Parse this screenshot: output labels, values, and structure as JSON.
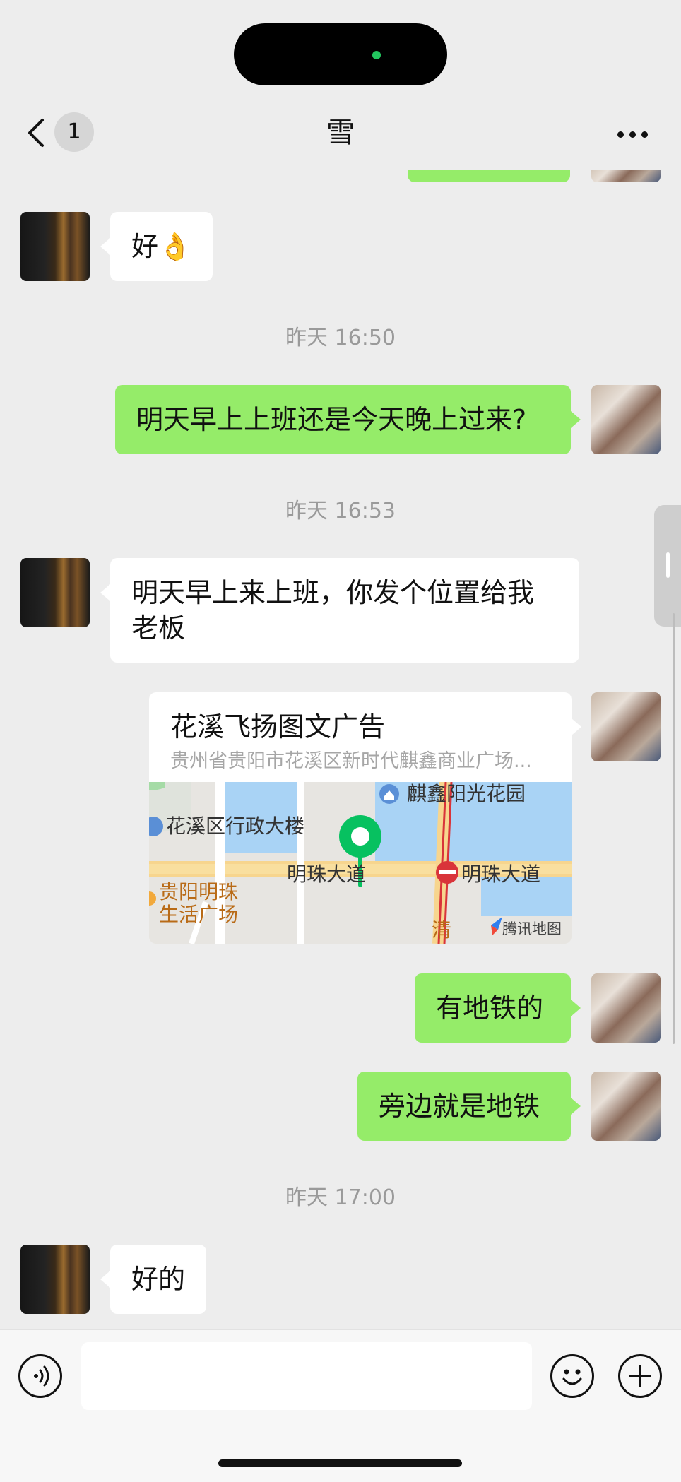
{
  "header": {
    "unread_count": "1",
    "title": "雪"
  },
  "messages": [
    {
      "side": "in",
      "text": "好👌"
    },
    {
      "time": "昨天 16:50"
    },
    {
      "side": "out",
      "text": "明天早上上班还是今天晚上过来?"
    },
    {
      "time": "昨天 16:53"
    },
    {
      "side": "in",
      "text_line1": "明天早上来上班，你发个位置给我",
      "text_line2": "老板"
    },
    {
      "side": "out",
      "type": "location",
      "name": "花溪飞扬图文广告",
      "address": "贵州省贵阳市花溪区新时代麒鑫商业广场...",
      "map_labels": {
        "poi_top": "麒鑫阳光花园",
        "poi_left": "花溪区行政大楼",
        "road_main": "明珠大道",
        "metro_station": "明珠大道",
        "mall_line1": "贵阳明珠",
        "mall_line2": "生活广场",
        "partial_label": "清",
        "provider": "腾讯地图"
      }
    },
    {
      "side": "out",
      "text": "有地铁的"
    },
    {
      "side": "out",
      "text": "旁边就是地铁"
    },
    {
      "time": "昨天 17:00"
    },
    {
      "side": "in",
      "text": "好的"
    }
  ],
  "input_bar": {
    "placeholder": "",
    "voice_icon": "voice-icon",
    "emoji_icon": "emoji-icon",
    "plus_icon": "plus-icon"
  },
  "colors": {
    "background": "#ededed",
    "outgoing_bubble": "#95ec69",
    "incoming_bubble": "#ffffff",
    "time_text": "#9a9a9a",
    "map_pin": "#07c160"
  }
}
